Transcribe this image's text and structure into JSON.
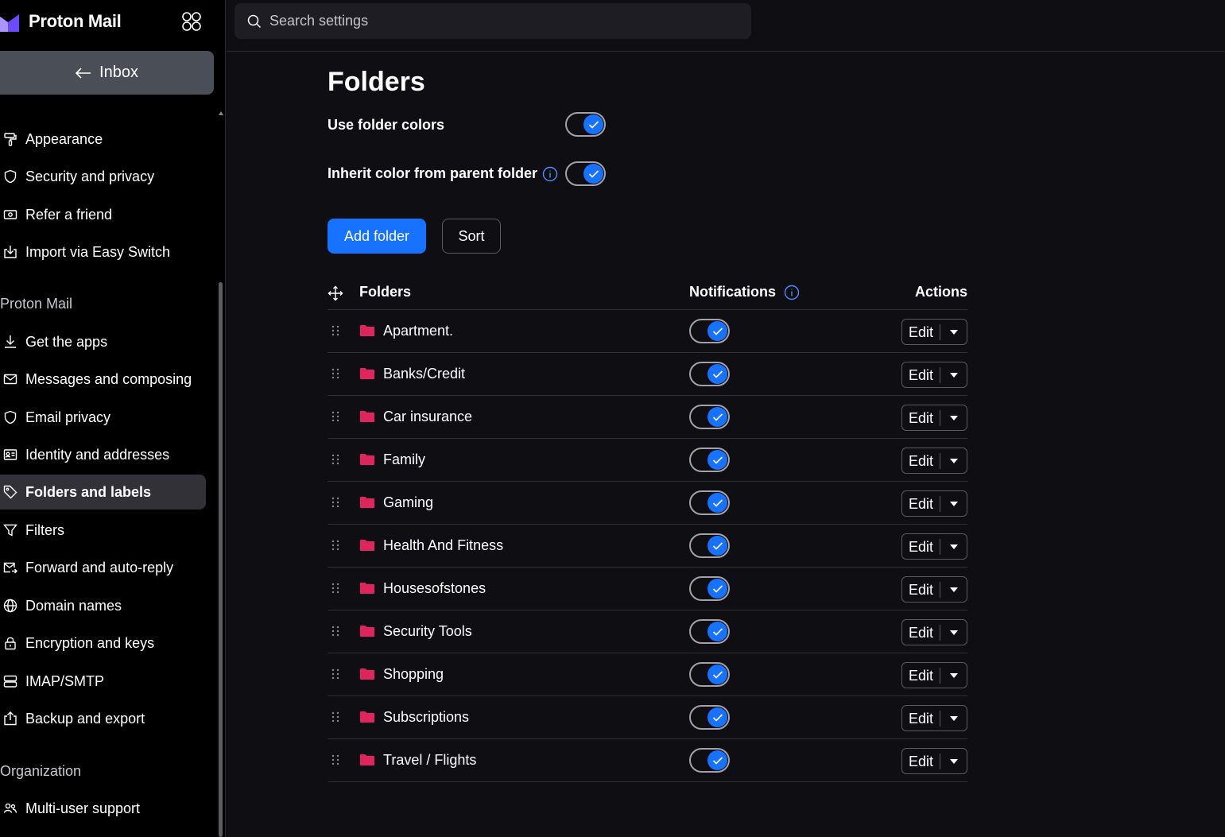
{
  "brand": {
    "name": "Proton Mail"
  },
  "inbox_button": {
    "label": "Inbox"
  },
  "search": {
    "placeholder": "Search settings"
  },
  "nav": {
    "items_top": [
      {
        "label": "Appearance",
        "icon": "paint-roller-icon"
      },
      {
        "label": "Security and privacy",
        "icon": "shield-icon"
      },
      {
        "label": "Refer a friend",
        "icon": "money-icon"
      },
      {
        "label": "Import via Easy Switch",
        "icon": "import-icon"
      }
    ],
    "section_mail": "Proton Mail",
    "items_mail": [
      {
        "label": "Get the apps",
        "icon": "download-icon"
      },
      {
        "label": "Messages and composing",
        "icon": "envelope-icon"
      },
      {
        "label": "Email privacy",
        "icon": "shield-icon"
      },
      {
        "label": "Identity and addresses",
        "icon": "id-card-icon"
      },
      {
        "label": "Folders and labels",
        "icon": "tag-icon",
        "active": true
      },
      {
        "label": "Filters",
        "icon": "filter-icon"
      },
      {
        "label": "Forward and auto-reply",
        "icon": "forward-icon"
      },
      {
        "label": "Domain names",
        "icon": "globe-icon"
      },
      {
        "label": "Encryption and keys",
        "icon": "lock-icon"
      },
      {
        "label": "IMAP/SMTP",
        "icon": "server-icon"
      },
      {
        "label": "Backup and export",
        "icon": "export-icon"
      }
    ],
    "section_org": "Organization",
    "items_org": [
      {
        "label": "Multi-user support",
        "icon": "users-icon"
      }
    ]
  },
  "main": {
    "title": "Folders",
    "use_folder_colors": {
      "label": "Use folder colors",
      "enabled": true
    },
    "inherit_color": {
      "label": "Inherit color from parent folder",
      "enabled": true
    },
    "add_folder_label": "Add folder",
    "sort_label": "Sort",
    "table": {
      "col_folders": "Folders",
      "col_notifications": "Notifications",
      "col_actions": "Actions",
      "edit_label": "Edit",
      "rows": [
        {
          "name": "Apartment.",
          "notifications": true
        },
        {
          "name": "Banks/Credit",
          "notifications": true
        },
        {
          "name": "Car insurance",
          "notifications": true
        },
        {
          "name": "Family",
          "notifications": true
        },
        {
          "name": "Gaming",
          "notifications": true
        },
        {
          "name": "Health And Fitness",
          "notifications": true
        },
        {
          "name": "Housesofstones",
          "notifications": true
        },
        {
          "name": "Security Tools",
          "notifications": true
        },
        {
          "name": "Shopping",
          "notifications": true
        },
        {
          "name": "Subscriptions",
          "notifications": true
        },
        {
          "name": "Travel / Flights",
          "notifications": true
        }
      ]
    }
  },
  "colors": {
    "accent": "#1672ff",
    "folder": "#e0245e",
    "active_nav": "#323138",
    "inbox_button": "#4a4f57"
  }
}
